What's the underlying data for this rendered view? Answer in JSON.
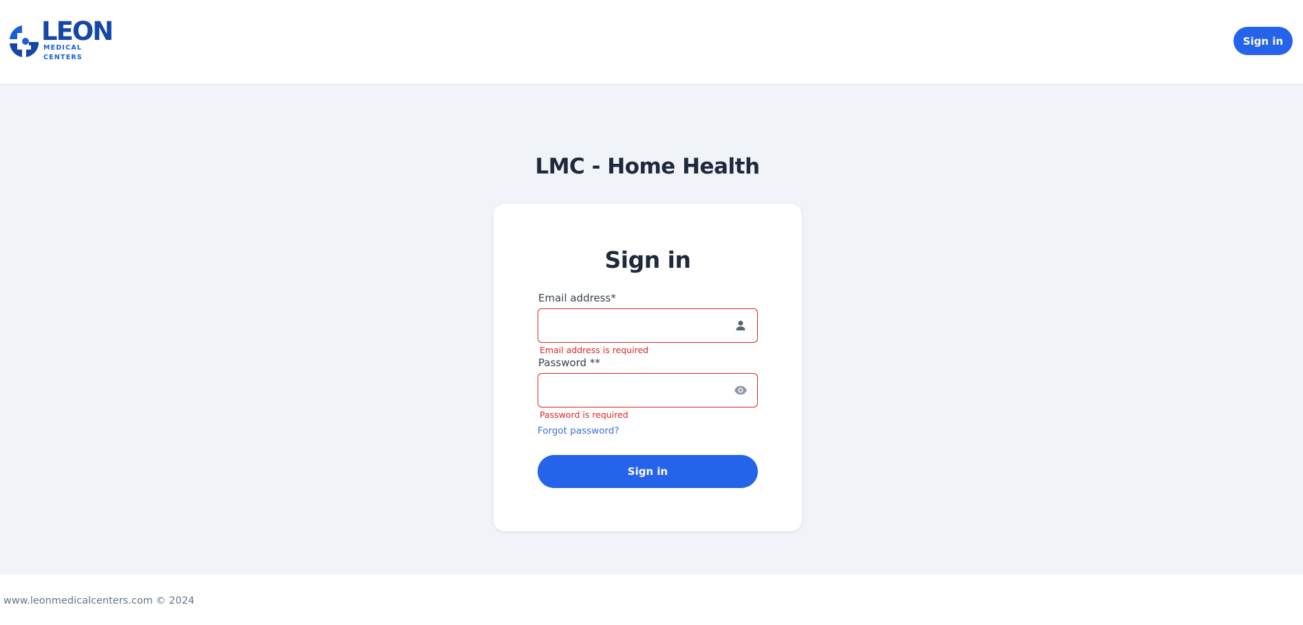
{
  "header": {
    "logo_word": "LEON",
    "logo_subtitle": "MEDICAL CENTERS",
    "signin_label": "Sign in"
  },
  "main": {
    "page_title": "LMC - Home Health",
    "card": {
      "title": "Sign in",
      "email": {
        "label": "Email address*",
        "value": "",
        "error": "Email address is required",
        "icon": "user-icon"
      },
      "password": {
        "label": "Password **",
        "value": "",
        "error": "Password is required",
        "icon": "eye-icon"
      },
      "forgot_label": "Forgot password?",
      "submit_label": "Sign in"
    }
  },
  "footer": {
    "text": "www.leonmedicalcenters.com © 2024"
  },
  "colors": {
    "brand_blue": "#2563eb",
    "logo_blue": "#1647a8",
    "error_red": "#dc2626",
    "background": "#f0f3f7"
  }
}
